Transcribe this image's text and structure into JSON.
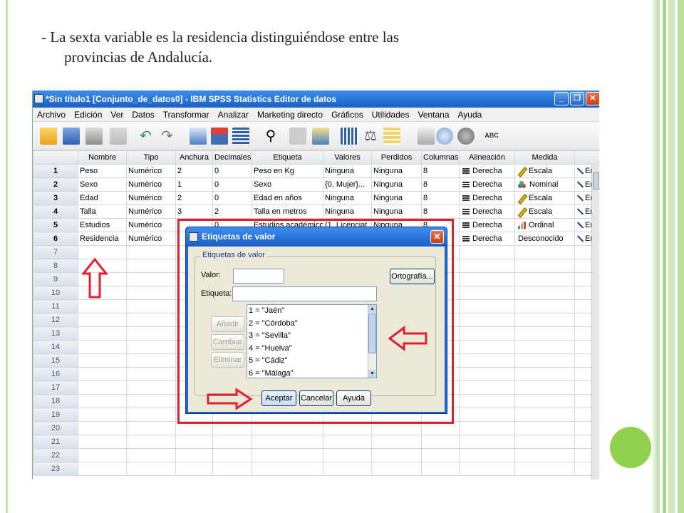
{
  "caption": {
    "line1": "- La sexta variable es la residencia distinguiéndose entre las",
    "line2": "provincias de Andalucía."
  },
  "window": {
    "title": "*Sin título1 [Conjunto_de_datos0] - IBM SPSS Statistics Editor de datos",
    "minimize": "_",
    "maximize": "❐",
    "close": "✕"
  },
  "menu": [
    "Archivo",
    "Edición",
    "Ver",
    "Datos",
    "Transformar",
    "Analizar",
    "Marketing directo",
    "Gráficos",
    "Utilidades",
    "Ventana",
    "Ayuda"
  ],
  "toolbar": {
    "icons": [
      "open-file-icon",
      "save-icon",
      "print-icon",
      "dialog-recall-icon",
      "undo-icon",
      "redo-icon",
      "goto-case-icon",
      "goto-variable-icon",
      "variables-icon",
      "find-icon",
      "insert-cases-icon",
      "insert-variable-icon",
      "split-file-icon",
      "weight-cases-icon",
      "select-cases-icon",
      "value-labels-icon",
      "use-sets-icon",
      "show-all-variables-icon",
      "spell-check-icon"
    ],
    "spell_label": "ABC"
  },
  "grid": {
    "columns": [
      "Nombre",
      "Tipo",
      "Anchura",
      "Decimales",
      "Etiqueta",
      "Valores",
      "Perdidos",
      "Columnas",
      "Alineación",
      "Medida",
      ""
    ],
    "rows": [
      {
        "n": "1",
        "nombre": "Peso",
        "tipo": "Numérico",
        "anchura": "2",
        "decimales": "0",
        "etiqueta": "Peso en Kg",
        "valores": "Ninguna",
        "perdidos": "Ninguna",
        "columnas": "8",
        "alineacion": "Derecha",
        "medida": "Escala",
        "medida_icon": "scale-icon",
        "rol": "En"
      },
      {
        "n": "2",
        "nombre": "Sexo",
        "tipo": "Numérico",
        "anchura": "1",
        "decimales": "0",
        "etiqueta": "Sexo",
        "valores": "{0, Mujer}...",
        "perdidos": "Ninguna",
        "columnas": "8",
        "alineacion": "Derecha",
        "medida": "Nominal",
        "medida_icon": "nominal-icon",
        "rol": "En"
      },
      {
        "n": "3",
        "nombre": "Edad",
        "tipo": "Numérico",
        "anchura": "2",
        "decimales": "0",
        "etiqueta": "Edad en años",
        "valores": "Ninguna",
        "perdidos": "Ninguna",
        "columnas": "8",
        "alineacion": "Derecha",
        "medida": "Escala",
        "medida_icon": "scale-icon",
        "rol": "En"
      },
      {
        "n": "4",
        "nombre": "Talla",
        "tipo": "Numérico",
        "anchura": "3",
        "decimales": "2",
        "etiqueta": "Talla en metros",
        "valores": "Ninguna",
        "perdidos": "Ninguna",
        "columnas": "8",
        "alineacion": "Derecha",
        "medida": "Escala",
        "medida_icon": "scale-icon",
        "rol": "En"
      },
      {
        "n": "5",
        "nombre": "Estudios",
        "tipo": "Numérico",
        "anchura": "",
        "decimales": "0",
        "etiqueta": "Estudios académicos",
        "valores": "{1, Licenciat...",
        "perdidos": "Ninguna",
        "columnas": "8",
        "alineacion": "Derecha",
        "medida": "Ordinal",
        "medida_icon": "ordinal-icon",
        "rol": "En"
      },
      {
        "n": "6",
        "nombre": "Residencia",
        "tipo": "Numérico",
        "anchura": "",
        "decimales": "",
        "etiqueta": "",
        "valores": "",
        "perdidos": "",
        "columnas": "",
        "alineacion": "Derecha",
        "medida": "Desconocido",
        "medida_icon": "",
        "rol": "En"
      }
    ],
    "empty_rows": [
      "7",
      "8",
      "9",
      "10",
      "11",
      "12",
      "13",
      "14",
      "15",
      "16",
      "17",
      "18",
      "19",
      "20",
      "21",
      "22",
      "23"
    ]
  },
  "dialog": {
    "title": "Etiquetas de valor",
    "close": "✕",
    "group_label": "Etiquetas de valor",
    "valor_label": "Valor:",
    "valor_value": "",
    "etiqueta_label": "Etiqueta:",
    "etiqueta_value": "",
    "spell_button": "Ortografía...",
    "add_button": "Añadir",
    "change_button": "Cambiar",
    "remove_button": "Eliminar",
    "labels": [
      "1 = \"Jaén\"",
      "2 = \"Córdoba\"",
      "3 = \"Sevilla\"",
      "4 = \"Huelva\"",
      "5 = \"Cádiz\"",
      "6 = \"Málaga\""
    ],
    "ok_button": "Aceptar",
    "cancel_button": "Cancelar",
    "help_button": "Ayuda"
  },
  "colors": {
    "annotation_red": "#e02030",
    "slide_green": "#8fd14f",
    "titlebar_blue": "#1a5fc7"
  }
}
